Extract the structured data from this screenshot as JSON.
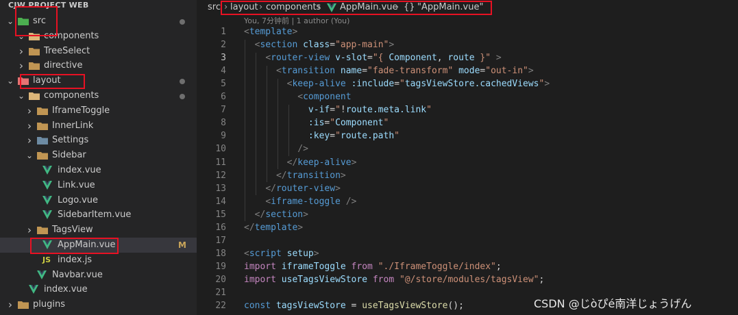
{
  "explorer": {
    "title": "CJW PROJECT WEB",
    "items": [
      {
        "label": "src",
        "kind": "folder-open",
        "icon": "src-folder-icon",
        "color": "#4caf50"
      },
      {
        "label": "components",
        "kind": "folder-open",
        "icon": "components-folder-icon",
        "color": "#dcb67a"
      },
      {
        "label": "TreeSelect",
        "kind": "folder",
        "icon": "folder-icon",
        "color": "#c09553"
      },
      {
        "label": "directive",
        "kind": "folder",
        "icon": "folder-icon",
        "color": "#c09553"
      },
      {
        "label": "layout",
        "kind": "folder-open",
        "icon": "layout-folder-icon",
        "color": "#e57373"
      },
      {
        "label": "components",
        "kind": "folder-open",
        "icon": "components-folder-icon",
        "color": "#dcb67a"
      },
      {
        "label": "IframeToggle",
        "kind": "folder",
        "icon": "folder-icon",
        "color": "#c09553"
      },
      {
        "label": "InnerLink",
        "kind": "folder",
        "icon": "folder-icon",
        "color": "#c09553"
      },
      {
        "label": "Settings",
        "kind": "folder",
        "icon": "settings-folder-icon",
        "color": "#6d8ba3"
      },
      {
        "label": "Sidebar",
        "kind": "folder-open",
        "icon": "folder-open-icon",
        "color": "#c09553"
      },
      {
        "label": "index.vue",
        "kind": "vue",
        "icon": "vue-icon",
        "color": "#41b883"
      },
      {
        "label": "Link.vue",
        "kind": "vue",
        "icon": "vue-icon",
        "color": "#41b883"
      },
      {
        "label": "Logo.vue",
        "kind": "vue",
        "icon": "vue-icon",
        "color": "#41b883"
      },
      {
        "label": "SidebarItem.vue",
        "kind": "vue",
        "icon": "vue-icon",
        "color": "#41b883"
      },
      {
        "label": "TagsView",
        "kind": "folder",
        "icon": "folder-icon",
        "color": "#c09553"
      },
      {
        "label": "AppMain.vue",
        "kind": "vue",
        "icon": "vue-icon",
        "color": "#41b883",
        "badge": "M"
      },
      {
        "label": "index.js",
        "kind": "js",
        "icon": "js-icon",
        "color": "#cbcb41",
        "icon_text": "JS"
      },
      {
        "label": "Navbar.vue",
        "kind": "vue",
        "icon": "vue-icon",
        "color": "#41b883"
      },
      {
        "label": "index.vue",
        "kind": "vue",
        "icon": "vue-icon",
        "color": "#41b883"
      },
      {
        "label": "plugins",
        "kind": "folder",
        "icon": "folder-icon",
        "color": "#c09553"
      }
    ]
  },
  "breadcrumb": {
    "root": "src",
    "sep": "›",
    "parts": [
      "layout",
      "components",
      "AppMain.vue",
      "\"AppMain.vue\""
    ],
    "symbol_icon": "{}"
  },
  "blame": "You, 7分钟前 | 1 author (You)",
  "code": [
    {
      "n": "1",
      "t": [
        [
          "tg",
          "<"
        ],
        [
          "tn",
          "template"
        ],
        [
          "tg",
          ">"
        ]
      ]
    },
    {
      "n": "2",
      "t": [
        [
          "pl",
          "  "
        ],
        [
          "tg",
          "<"
        ],
        [
          "tn",
          "section"
        ],
        [
          "pl",
          " "
        ],
        [
          "at",
          "class"
        ],
        [
          "pl",
          "="
        ],
        [
          "st",
          "\"app-main\""
        ],
        [
          "tg",
          ">"
        ]
      ]
    },
    {
      "n": "3",
      "t": [
        [
          "pl",
          "    "
        ],
        [
          "tg",
          "<"
        ],
        [
          "tn",
          "router-view"
        ],
        [
          "pl",
          " "
        ],
        [
          "at",
          "v-slot"
        ],
        [
          "pl",
          "="
        ],
        [
          "st",
          "\"{ "
        ],
        [
          "vr",
          "Component"
        ],
        [
          "pl",
          ", "
        ],
        [
          "vr",
          "route"
        ],
        [
          "st",
          " }\""
        ],
        [
          "pl",
          " "
        ],
        [
          "tg",
          ">"
        ]
      ]
    },
    {
      "n": "4",
      "t": [
        [
          "pl",
          "      "
        ],
        [
          "tg",
          "<"
        ],
        [
          "tn",
          "transition"
        ],
        [
          "pl",
          " "
        ],
        [
          "at",
          "name"
        ],
        [
          "pl",
          "="
        ],
        [
          "st",
          "\"fade-transform\""
        ],
        [
          "pl",
          " "
        ],
        [
          "at",
          "mode"
        ],
        [
          "pl",
          "="
        ],
        [
          "st",
          "\"out-in\""
        ],
        [
          "tg",
          ">"
        ]
      ]
    },
    {
      "n": "5",
      "t": [
        [
          "pl",
          "        "
        ],
        [
          "tg",
          "<"
        ],
        [
          "tn",
          "keep-alive"
        ],
        [
          "pl",
          " "
        ],
        [
          "at",
          ":include"
        ],
        [
          "pl",
          "="
        ],
        [
          "st",
          "\""
        ],
        [
          "vr",
          "tagsViewStore.cachedViews"
        ],
        [
          "st",
          "\""
        ],
        [
          "tg",
          ">"
        ]
      ]
    },
    {
      "n": "6",
      "t": [
        [
          "pl",
          "          "
        ],
        [
          "tg",
          "<"
        ],
        [
          "tn",
          "component"
        ]
      ]
    },
    {
      "n": "7",
      "t": [
        [
          "pl",
          "            "
        ],
        [
          "at",
          "v-if"
        ],
        [
          "pl",
          "="
        ],
        [
          "st",
          "\""
        ],
        [
          "pl",
          "!"
        ],
        [
          "vr",
          "route.meta.link"
        ],
        [
          "st",
          "\""
        ]
      ]
    },
    {
      "n": "8",
      "t": [
        [
          "pl",
          "            "
        ],
        [
          "at",
          ":is"
        ],
        [
          "pl",
          "="
        ],
        [
          "st",
          "\""
        ],
        [
          "vr",
          "Component"
        ],
        [
          "st",
          "\""
        ]
      ]
    },
    {
      "n": "9",
      "t": [
        [
          "pl",
          "            "
        ],
        [
          "at",
          ":key"
        ],
        [
          "pl",
          "="
        ],
        [
          "st",
          "\""
        ],
        [
          "vr",
          "route.path"
        ],
        [
          "st",
          "\""
        ]
      ]
    },
    {
      "n": "10",
      "t": [
        [
          "pl",
          "          "
        ],
        [
          "tg",
          "/>"
        ]
      ]
    },
    {
      "n": "11",
      "t": [
        [
          "pl",
          "        "
        ],
        [
          "tg",
          "</"
        ],
        [
          "tn",
          "keep-alive"
        ],
        [
          "tg",
          ">"
        ]
      ]
    },
    {
      "n": "12",
      "t": [
        [
          "pl",
          "      "
        ],
        [
          "tg",
          "</"
        ],
        [
          "tn",
          "transition"
        ],
        [
          "tg",
          ">"
        ]
      ]
    },
    {
      "n": "13",
      "t": [
        [
          "pl",
          "    "
        ],
        [
          "tg",
          "</"
        ],
        [
          "tn",
          "router-view"
        ],
        [
          "tg",
          ">"
        ]
      ]
    },
    {
      "n": "14",
      "t": [
        [
          "pl",
          "    "
        ],
        [
          "tg",
          "<"
        ],
        [
          "tn",
          "iframe-toggle"
        ],
        [
          "pl",
          " "
        ],
        [
          "tg",
          "/>"
        ]
      ]
    },
    {
      "n": "15",
      "t": [
        [
          "pl",
          "  "
        ],
        [
          "tg",
          "</"
        ],
        [
          "tn",
          "section"
        ],
        [
          "tg",
          ">"
        ]
      ]
    },
    {
      "n": "16",
      "t": [
        [
          "tg",
          "</"
        ],
        [
          "tn",
          "template"
        ],
        [
          "tg",
          ">"
        ]
      ]
    },
    {
      "n": "17",
      "t": []
    },
    {
      "n": "18",
      "t": [
        [
          "tg",
          "<"
        ],
        [
          "tn",
          "script"
        ],
        [
          "pl",
          " "
        ],
        [
          "at",
          "setup"
        ],
        [
          "tg",
          ">"
        ]
      ]
    },
    {
      "n": "19",
      "t": [
        [
          "kw",
          "import"
        ],
        [
          "pl",
          " "
        ],
        [
          "vr",
          "iframeToggle"
        ],
        [
          "pl",
          " "
        ],
        [
          "kw",
          "from"
        ],
        [
          "pl",
          " "
        ],
        [
          "st",
          "\"./IframeToggle/index\""
        ],
        [
          "pl",
          ";"
        ]
      ]
    },
    {
      "n": "20",
      "t": [
        [
          "kw",
          "import"
        ],
        [
          "pl",
          " "
        ],
        [
          "vr",
          "useTagsViewStore"
        ],
        [
          "pl",
          " "
        ],
        [
          "kw",
          "from"
        ],
        [
          "pl",
          " "
        ],
        [
          "st",
          "\"@/store/modules/tagsView\""
        ],
        [
          "pl",
          ";"
        ]
      ]
    },
    {
      "n": "21",
      "t": []
    },
    {
      "n": "22",
      "t": [
        [
          "tn",
          "const"
        ],
        [
          "pl",
          " "
        ],
        [
          "vr",
          "tagsViewStore"
        ],
        [
          "pl",
          " = "
        ],
        [
          "fn",
          "useTagsViewStore"
        ],
        [
          "pl",
          "();"
        ]
      ]
    }
  ],
  "watermark": "CSDN @じòぴé南洋じょうげん"
}
